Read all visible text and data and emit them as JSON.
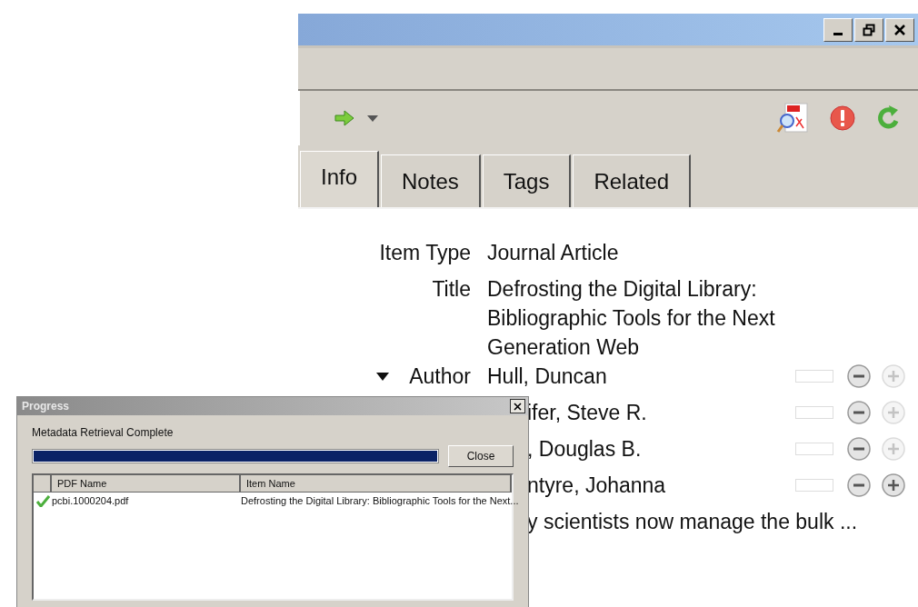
{
  "main_window": {
    "tabs": [
      {
        "label": "Info",
        "selected": true
      },
      {
        "label": "Notes",
        "selected": false
      },
      {
        "label": "Tags",
        "selected": false
      },
      {
        "label": "Related",
        "selected": false
      }
    ],
    "fields": [
      {
        "kind": "field",
        "label": "Item Type",
        "value": "Journal Article"
      },
      {
        "kind": "field",
        "label": "Title",
        "value": "Defrosting the Digital Library: Bibliographic Tools for the Next Generation Web"
      },
      {
        "kind": "author",
        "label": "Author",
        "value": "Hull, Duncan",
        "plus_enabled": false
      },
      {
        "kind": "author_partial",
        "value": "ifer, Steve R.",
        "plus_enabled": false
      },
      {
        "kind": "author_partial",
        "value": ", Douglas B.",
        "plus_enabled": false
      },
      {
        "kind": "author_partial",
        "value": "ntyre, Johanna",
        "plus_enabled": true
      },
      {
        "kind": "text_partial",
        "value": "y scientists now manage the bulk ..."
      }
    ]
  },
  "progress_dialog": {
    "title": "Progress",
    "message": "Metadata Retrieval Complete",
    "level": 1,
    "close_button": "Close",
    "table": {
      "columns": [
        "PDF Name",
        "Item Name"
      ],
      "rows": [
        {
          "done": true,
          "pdf_name": "pcbi.1000204.pdf",
          "item_name": "Defrosting the Digital Library: Bibliographic Tools for the Next..."
        }
      ]
    }
  }
}
